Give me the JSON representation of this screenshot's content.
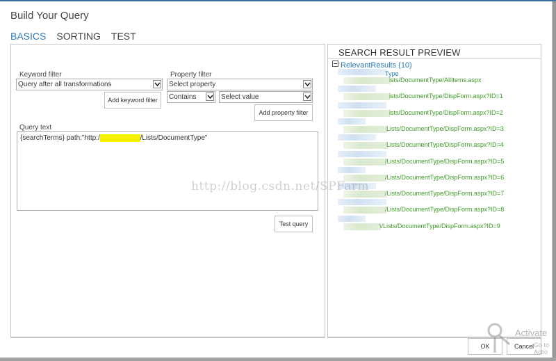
{
  "dialog": {
    "title": "Build Your Query",
    "tabs": [
      {
        "label": "BASICS",
        "active": true
      },
      {
        "label": "SORTING",
        "active": false
      },
      {
        "label": "TEST",
        "active": false
      }
    ]
  },
  "basics": {
    "keyword_filter": {
      "label": "Keyword filter",
      "selected": "Query after all transformations",
      "add_button": "Add keyword filter"
    },
    "property_filter": {
      "label": "Property filter",
      "property_selected": "Select property",
      "operator_selected": "Contains",
      "value_selected": "Select value",
      "add_button": "Add property filter"
    },
    "query_text": {
      "label": "Query text",
      "value_prefix": "{searchTerms} path:\"http:/",
      "value_redacted": "/xxxxxxxxxxx",
      "value_suffix": "/Lists/DocumentType\""
    },
    "test_query_button": "Test query"
  },
  "preview": {
    "title": "SEARCH RESULT PREVIEW",
    "root": "RelevantResults (10)",
    "first_title_suffix": "Type",
    "results": [
      "ists/DocumentType/AllItems.aspx",
      "ists/DocumentType/DispForm.aspx?ID=1",
      "ists/DocumentType/DispForm.aspx?ID=2",
      "Lists/DocumentType/DispForm.aspx?ID=3",
      "Lists/DocumentType/DispForm.aspx?ID=4",
      "/Lists/DocumentType/DispForm.aspx?ID=5",
      "/Lists/DocumentType/DispForm.aspx?ID=6",
      "/Lists/DocumentType/DispForm.aspx?ID=7",
      "/Lists/DocumentType/DispForm.aspx?ID=8",
      "\\/Lists/DocumentType/DispForm.aspx?ID=9"
    ]
  },
  "footer": {
    "ok": "OK",
    "cancel": "Cancel"
  },
  "overlays": {
    "watermark": "http://blog.csdn.net/SPFarm",
    "activate_line1": "Activate",
    "activate_line2": "Go to Actio"
  }
}
